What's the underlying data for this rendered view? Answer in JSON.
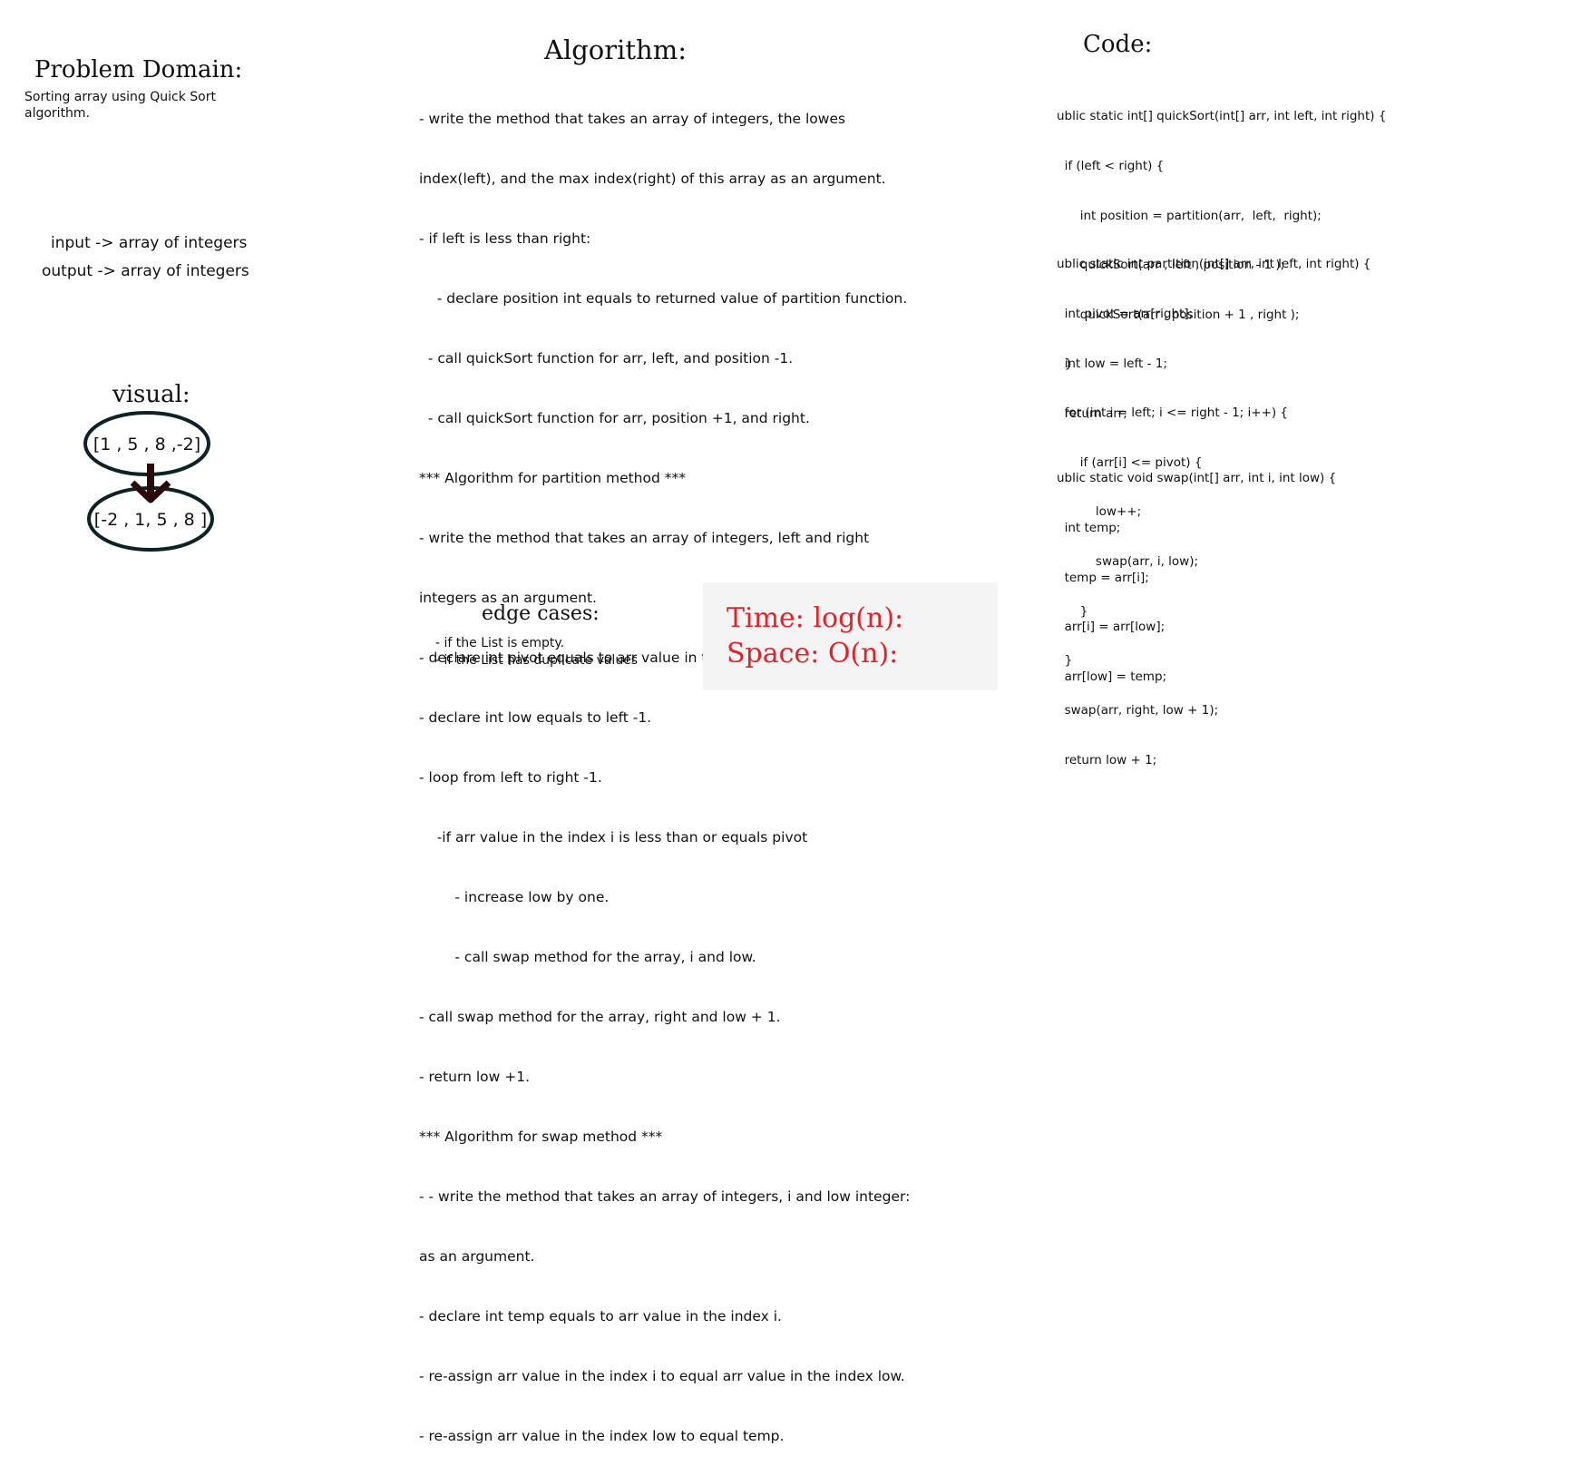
{
  "problem_domain": {
    "title": "Problem Domain:",
    "description": [
      "Sorting array using Quick Sort",
      "algorithm."
    ],
    "input": "input -> array of integers",
    "output": "output -> array of integers"
  },
  "visual": {
    "title": "visual:",
    "before": "[1 , 5 , 8 ,-2]",
    "after": "[-2 , 1, 5 , 8 ]"
  },
  "algorithm": {
    "title": "Algorithm:",
    "lines": [
      "- write the method that takes an array of integers, the lowes",
      "index(left), and the max index(right) of this array as an argument.",
      "- if left is less than right:",
      "    - declare position int equals to returned value of partition function.",
      "  - call quickSort function for arr, left, and position -1.",
      "  - call quickSort function for arr, position +1, and right.",
      "*** Algorithm for partition method ***",
      "- write the method that takes an array of integers, left and right",
      "integers as an argument.",
      "- declare int pivot equals to arr value in the index right.",
      "- declare int low equals to left -1.",
      "- loop from left to right -1.",
      "    -if arr value in the index i is less than or equals pivot",
      "        - increase low by one.",
      "        - call swap method for the array, i and low.",
      "- call swap method for the array, right and low + 1.",
      "- return low +1.",
      "*** Algorithm for swap method ***",
      "- - write the method that takes an array of integers, i and low integer:",
      "as an argument.",
      "- declare int temp equals to arr value in the index i.",
      "- re-assign arr value in the index i to equal arr value in the index low.",
      "- re-assign arr value in the index low to equal temp."
    ]
  },
  "code": {
    "title": "Code:",
    "blocks": [
      [
        "ublic static int[] quickSort(int[] arr, int left, int right) {",
        "  if (left < right) {",
        "      int position = partition(arr,  left,  right);",
        "      quickSort(arr , left , position - 1 );",
        "      quickSort(arr , position + 1 , right );",
        "  }",
        "  return arr;"
      ],
      [
        "ublic static int partition(int[] arr, int left, int right) {",
        "  int pivot = arr[right];",
        "  int low = left - 1;",
        "  for (int i = left; i <= right - 1; i++) {",
        "      if (arr[i] <= pivot) {",
        "          low++;",
        "          swap(arr, i, low);",
        "      }",
        "  }",
        "  swap(arr, right, low + 1);",
        "  return low + 1;"
      ],
      [
        "ublic static void swap(int[] arr, int i, int low) {",
        "  int temp;",
        "  temp = arr[i];",
        "  arr[i] = arr[low];",
        "  arr[low] = temp;"
      ]
    ]
  },
  "edge_cases": {
    "title": "edge cases:",
    "items": [
      "- if the List is empty.",
      "- if the List has duplicate values"
    ]
  },
  "complexity": {
    "time": "Time: log(n):",
    "space": "Space: O(n):"
  }
}
